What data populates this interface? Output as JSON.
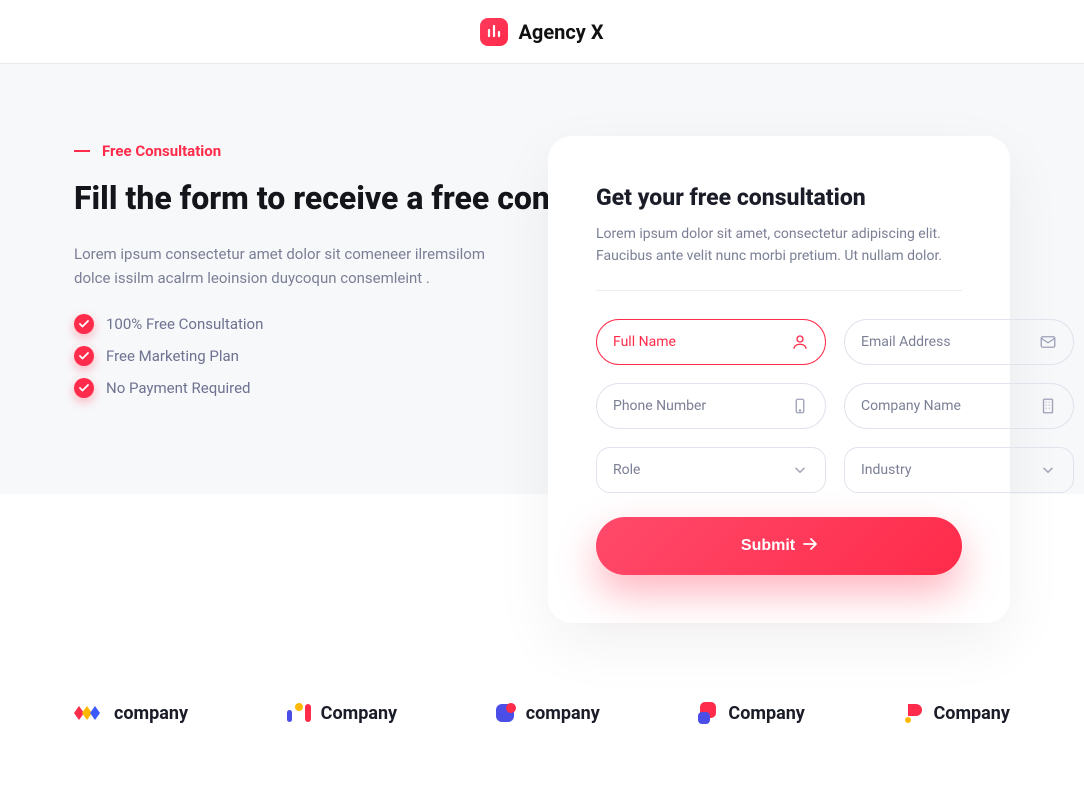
{
  "header": {
    "brand": "Agency X"
  },
  "hero": {
    "eyebrow": "Free Consultation",
    "title": "Fill the form to receive a free consultation",
    "subtitle": "Lorem ipsum consectetur amet dolor sit comeneer ilremsilom dolce issilm acalrm leoinsion duycoqun consemleint .",
    "checks": [
      "100% Free Consultation",
      "Free Marketing Plan",
      "No Payment Required"
    ]
  },
  "form": {
    "title": "Get your free consultation",
    "subtitle": "Lorem ipsum dolor sit amet, consectetur adipiscing elit. Faucibus ante velit nunc morbi pretium. Ut nullam dolor.",
    "fields": {
      "fullName": {
        "placeholder": "Full Name"
      },
      "email": {
        "placeholder": "Email Address"
      },
      "phone": {
        "placeholder": "Phone Number"
      },
      "company": {
        "placeholder": "Company Name"
      },
      "role": {
        "placeholder": "Role"
      },
      "industry": {
        "placeholder": "Industry"
      }
    },
    "submitLabel": "Submit"
  },
  "companyLogos": {
    "a": "company",
    "b": "Company",
    "c": "company",
    "d": "Company",
    "e": "Company"
  },
  "colors": {
    "accent": "#ff2b4a"
  }
}
